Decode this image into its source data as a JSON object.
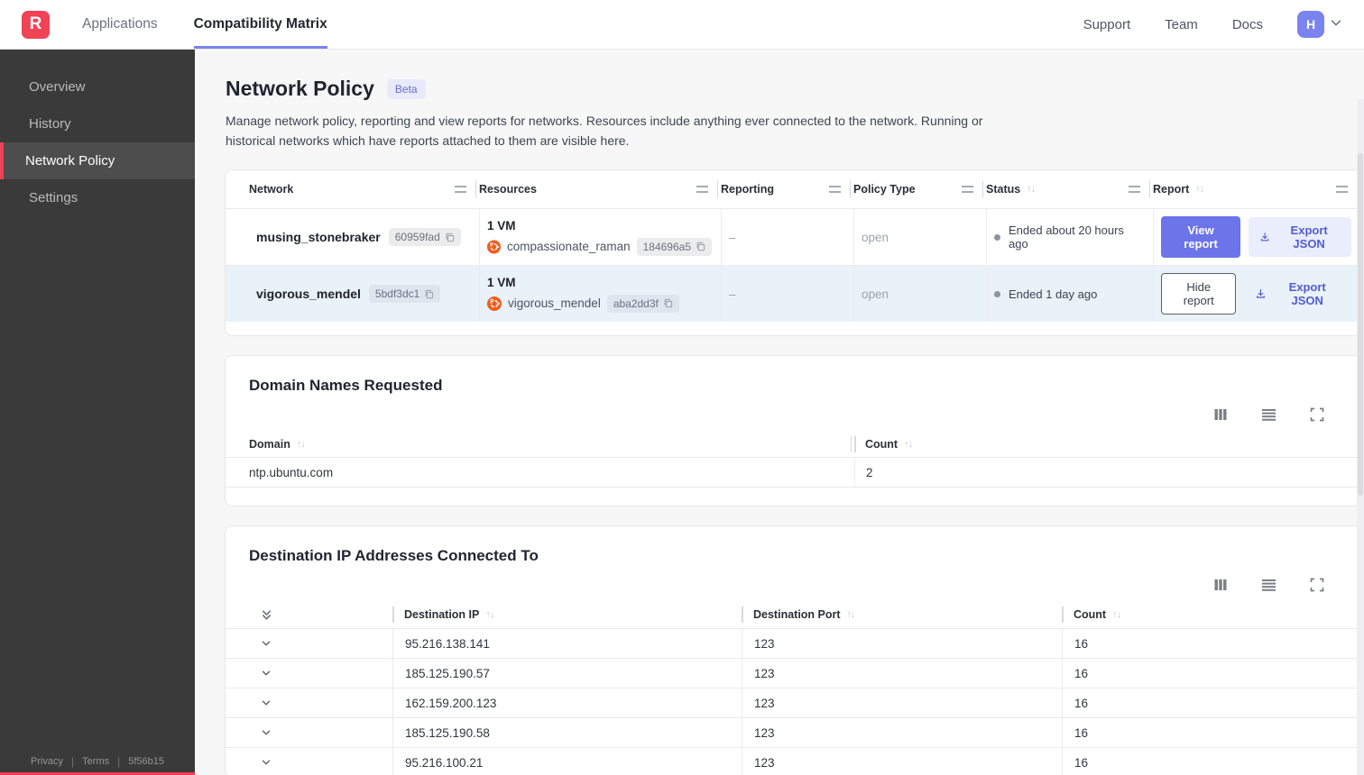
{
  "colors": {
    "accent": "#6b74e8",
    "brand_red": "#f04355",
    "row_highlight": "#e9f1f9",
    "avatar": "#7b83ee",
    "tab_underline": "#7b83ee"
  },
  "topbar": {
    "logo_letter": "R",
    "tabs": [
      {
        "label": "Applications"
      },
      {
        "label": "Compatibility Matrix"
      }
    ],
    "links": [
      "Support",
      "Team",
      "Docs"
    ],
    "avatar_letter": "H"
  },
  "sidebar": {
    "items": [
      "Overview",
      "History",
      "Network Policy",
      "Settings"
    ],
    "footer": {
      "privacy": "Privacy",
      "terms": "Terms",
      "version": "5f56b15"
    }
  },
  "page": {
    "title": "Network Policy",
    "badge": "Beta",
    "description": "Manage network policy, reporting and view reports for networks. Resources include anything ever connected to the network. Running or historical networks which have reports attached to them are visible here."
  },
  "networks_table": {
    "columns": [
      "Network",
      "Resources",
      "Reporting",
      "Policy Type",
      "Status",
      "Report"
    ],
    "rows": [
      {
        "name": "musing_stonebraker",
        "id": "60959fad",
        "vm_count": "1 VM",
        "vm_name": "compassionate_raman",
        "vm_id": "184696a5",
        "reporting": "–",
        "policy_type": "open",
        "status": "Ended about 20 hours ago",
        "report_action": "View report",
        "export_action": "Export JSON"
      },
      {
        "name": "vigorous_mendel",
        "id": "5bdf3dc1",
        "vm_count": "1 VM",
        "vm_name": "vigorous_mendel",
        "vm_id": "aba2dd3f",
        "reporting": "–",
        "policy_type": "open",
        "status": "Ended 1 day ago",
        "report_action": "Hide report",
        "export_action": "Export JSON"
      }
    ]
  },
  "domains_section": {
    "title": "Domain Names Requested",
    "columns": [
      "Domain",
      "Count"
    ],
    "rows": [
      {
        "domain": "ntp.ubuntu.com",
        "count": "2"
      }
    ]
  },
  "destinations_section": {
    "title": "Destination IP Addresses Connected To",
    "columns": [
      "Destination IP",
      "Destination Port",
      "Count"
    ],
    "rows": [
      {
        "ip": "95.216.138.141",
        "port": "123",
        "count": "16"
      },
      {
        "ip": "185.125.190.57",
        "port": "123",
        "count": "16"
      },
      {
        "ip": "162.159.200.123",
        "port": "123",
        "count": "16"
      },
      {
        "ip": "185.125.190.58",
        "port": "123",
        "count": "16"
      },
      {
        "ip": "95.216.100.21",
        "port": "123",
        "count": "16"
      }
    ]
  }
}
